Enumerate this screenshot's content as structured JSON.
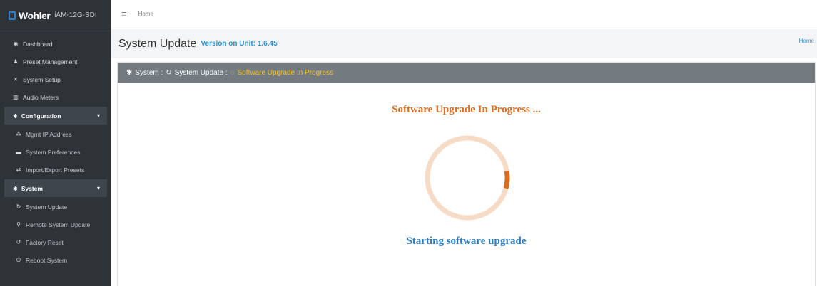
{
  "brand": {
    "logo": "Wohler",
    "model": "iAM-12G-SDI"
  },
  "topbar": {
    "menu_icon": "hamburger-icon",
    "breadcrumb": "Home"
  },
  "sidebar": {
    "items_top": [
      {
        "label": "Dashboard",
        "icon": "dashboard-icon",
        "glyph": "◉"
      },
      {
        "label": "Preset Management",
        "icon": "users-icon",
        "glyph": "♟"
      },
      {
        "label": "System Setup",
        "icon": "tools-icon",
        "glyph": "✕"
      },
      {
        "label": "Audio Meters",
        "icon": "bar-chart-icon",
        "glyph": "▥"
      }
    ],
    "configuration": {
      "label": "Configuration",
      "icon": "gear-icon",
      "items": [
        {
          "label": "Mgmt IP Address",
          "icon": "network-icon",
          "glyph": "⁂"
        },
        {
          "label": "System Preferences",
          "icon": "preferences-icon",
          "glyph": "▬"
        },
        {
          "label": "Import/Export Presets",
          "icon": "exchange-icon",
          "glyph": "⇄"
        }
      ]
    },
    "system": {
      "label": "System",
      "icon": "gears-icon",
      "items": [
        {
          "label": "System Update",
          "icon": "refresh-icon",
          "glyph": "↻"
        },
        {
          "label": "Remote System Update",
          "icon": "remote-network-icon",
          "glyph": "⚲"
        },
        {
          "label": "Factory Reset",
          "icon": "undo-icon",
          "glyph": "↺"
        },
        {
          "label": "Reboot System",
          "icon": "power-icon",
          "glyph": "⏻"
        }
      ]
    }
  },
  "page": {
    "title": "System Update",
    "version": "Version on Unit: 1.6.45",
    "home_link": "Home"
  },
  "card": {
    "crumb_system": "System :",
    "crumb_update": "System Update :",
    "crumb_active": "Software Upgrade In Progress"
  },
  "progress": {
    "title": "Software Upgrade In Progress ...",
    "status": "Starting software upgrade",
    "percent": 7
  },
  "colors": {
    "sidebar_bg": "#2e3338",
    "card_header_bg": "#737a80",
    "progress_orange": "#d96c1e",
    "status_blue": "#2a7fc8",
    "version_blue": "#2a8fcf",
    "crumb_active": "#f1c232"
  }
}
